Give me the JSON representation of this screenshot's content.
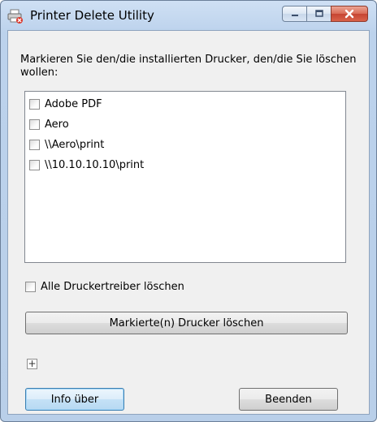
{
  "window": {
    "title": "Printer Delete Utility"
  },
  "description": "Markieren Sie den/die installierten Drucker, den/die Sie löschen wollen:",
  "printers": [
    {
      "label": "Adobe PDF",
      "checked": false
    },
    {
      "label": "Aero",
      "checked": false
    },
    {
      "label": "\\\\Aero\\print",
      "checked": false
    },
    {
      "label": "\\\\10.10.10.10\\print",
      "checked": false
    }
  ],
  "delete_all_drivers": {
    "label": "Alle Druckertreiber löschen",
    "checked": false
  },
  "buttons": {
    "delete_selected": "Markierte(n) Drucker löschen",
    "expand": "+",
    "info": "Info über",
    "exit": "Beenden"
  }
}
